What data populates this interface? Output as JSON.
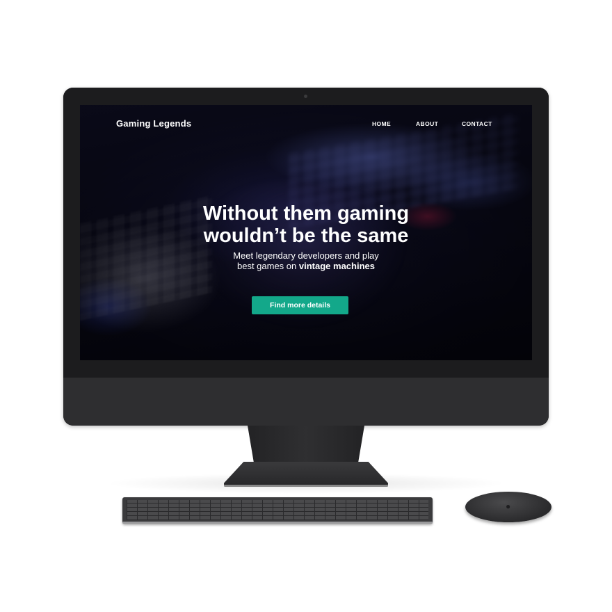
{
  "website": {
    "brand": "Gaming Legends",
    "nav": [
      "HOME",
      "ABOUT",
      "CONTACT"
    ],
    "hero": {
      "title_line1": "Without them gaming",
      "title_line2": "wouldn’t be the same",
      "subtitle_line1": "Meet legendary developers and play",
      "subtitle_line2_prefix": "best games on",
      "subtitle_line2_bold": "vintage machines"
    },
    "cta_label": "Find more details"
  },
  "colors": {
    "cta": "#13a88a",
    "bezel": "#1c1c1e",
    "device": "#2e2e30"
  },
  "icons": {
    "mouse_logo": "apple-logo-icon"
  }
}
